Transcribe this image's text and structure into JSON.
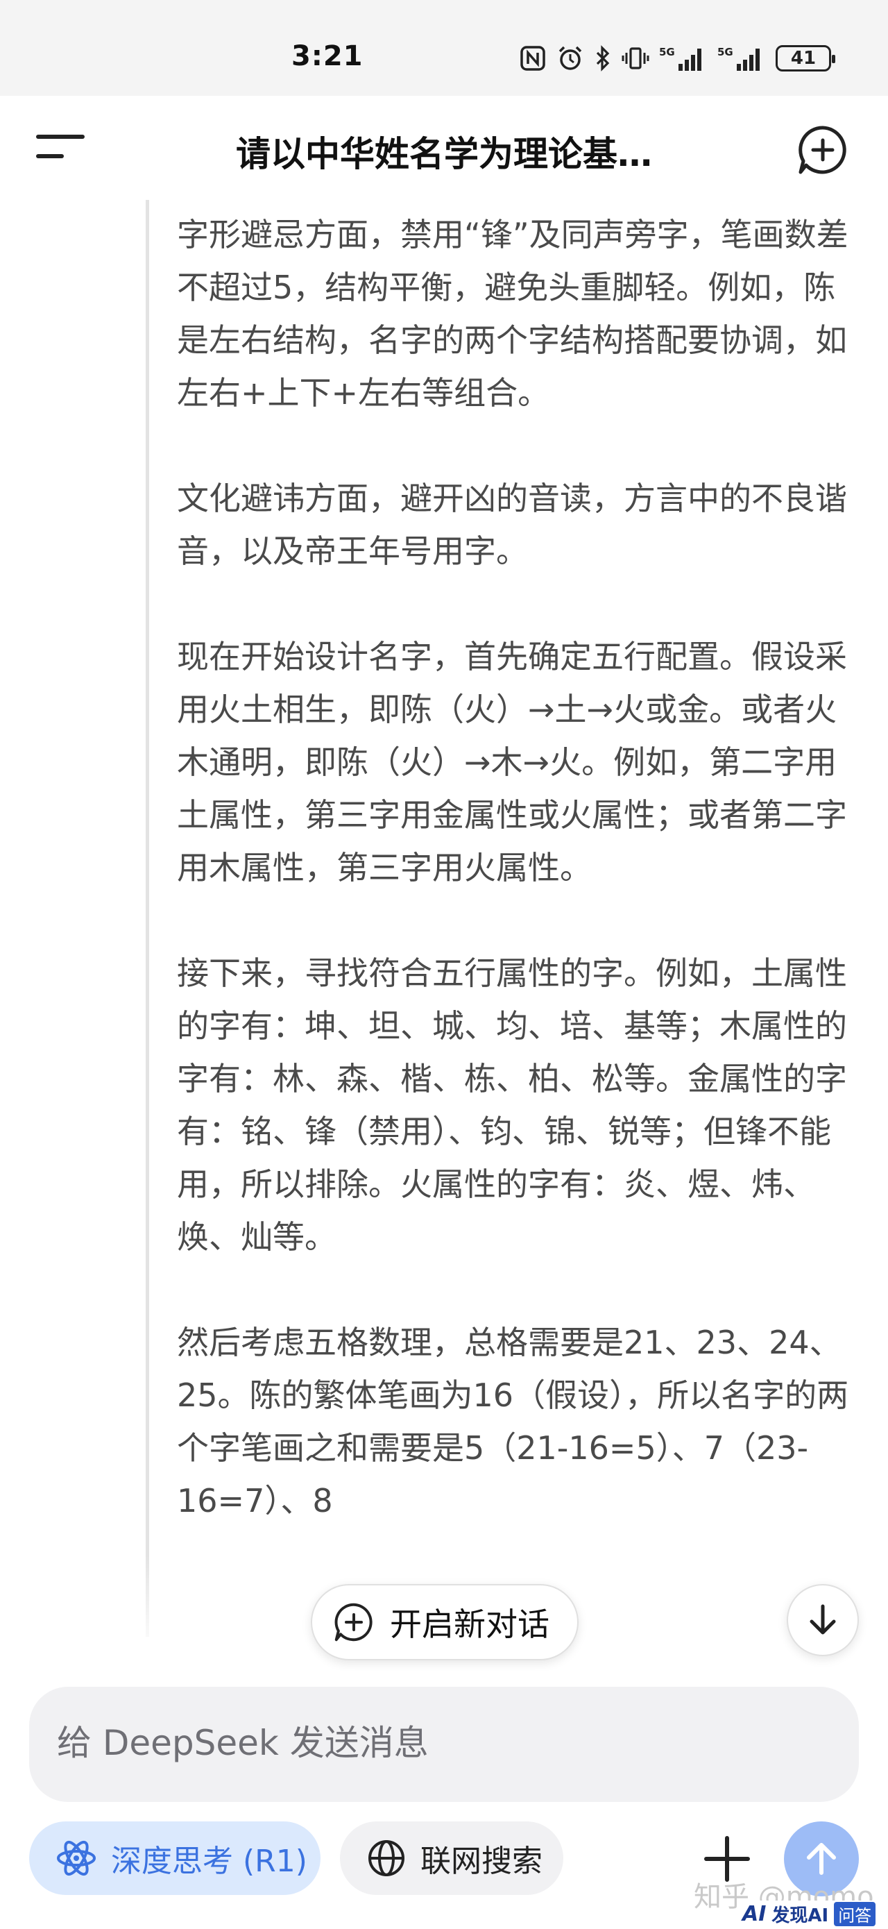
{
  "status_bar": {
    "time": "3:21",
    "battery": "41",
    "network_labels": [
      "5G",
      "5G"
    ]
  },
  "header": {
    "title": "请以中华姓名学为理论基…"
  },
  "thinking": {
    "paragraphs": [
      "字形避忌方面，禁用“锋”及同声旁字，笔画数差不超过5，结构平衡，避免头重脚轻。例如，陈是左右结构，名字的两个字结构搭配要协调，如左右+上下+左右等组合。",
      "文化避讳方面，避开凶的音读，方言中的不良谐音，以及帝王年号用字。",
      "现在开始设计名字，首先确定五行配置。假设采用火土相生，即陈（火）→土→火或金。或者火木通明，即陈（火）→木→火。例如，第二字用土属性，第三字用金属性或火属性；或者第二字用木属性，第三字用火属性。",
      "接下来，寻找符合五行属性的字。例如，土属性的字有：坤、坦、城、均、培、基等；木属性的字有：林、森、楷、栋、柏、松等。金属性的字有：铭、锋（禁用）、钧、锦、锐等；但锋不能用，所以排除。火属性的字有：炎、煜、炜、焕、灿等。",
      "然后考虑五格数理，总格需要是21、23、24、25。陈的繁体笔画为16（假设），所以名字的两个字笔画之和需要是5（21-16=5）、7（23-16=7）、8"
    ]
  },
  "floating": {
    "new_chat_label": "开启新对话"
  },
  "input": {
    "placeholder": "给 DeepSeek 发送消息"
  },
  "toolbar": {
    "deep_think_label": "深度思考 (R1)",
    "web_search_label": "联网搜索"
  },
  "watermarks": {
    "zhihu": "知乎 @momo",
    "brand_ai": "AI",
    "brand_name": "发现AI",
    "brand_qa": "问答"
  },
  "colors": {
    "accent_blue": "#3b72e0",
    "deep_think_bg": "#dbe9fd",
    "send_button": "#9dbcf6",
    "thinking_text": "#4a4a4a"
  }
}
